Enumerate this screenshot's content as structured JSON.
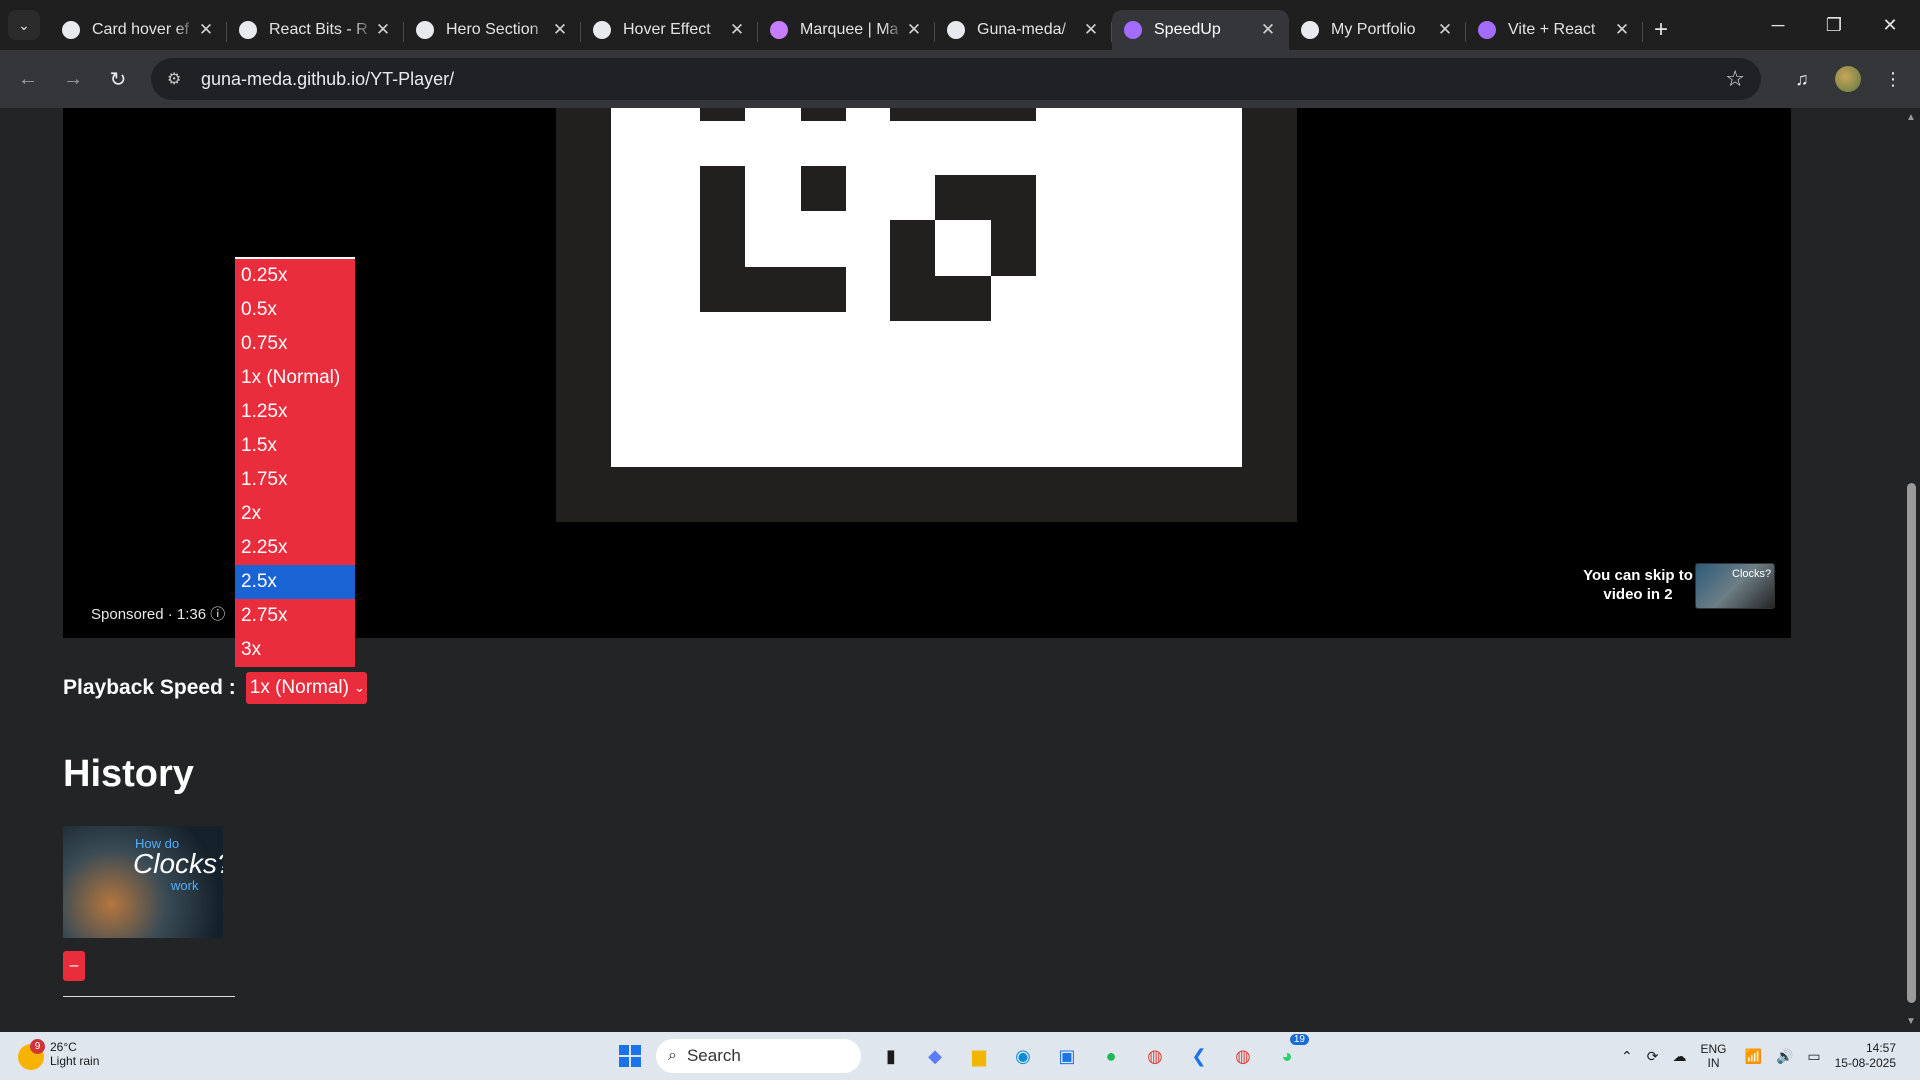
{
  "browser": {
    "tabs": [
      {
        "title": "Card hover ef",
        "favicon_color": "#e8eaed"
      },
      {
        "title": "React Bits - R",
        "favicon_color": "#e8eaed"
      },
      {
        "title": "Hero Section",
        "favicon_color": "#e8eaed"
      },
      {
        "title": "Hover Effect",
        "favicon_color": "#e8eaed"
      },
      {
        "title": "Marquee | Ma",
        "favicon_color": "#c77dff"
      },
      {
        "title": "Guna-meda/",
        "favicon_color": "#e8eaed"
      },
      {
        "title": "SpeedUp",
        "favicon_color": "#a46bff",
        "active": true
      },
      {
        "title": "My Portfolio",
        "favicon_color": "#e8eaed"
      },
      {
        "title": "Vite + React",
        "favicon_color": "#a46bff"
      }
    ],
    "url": "guna-meda.github.io/YT-Player/"
  },
  "player": {
    "sponsored_text": "Sponsored · 1:36",
    "skip_text_line1": "You can skip to",
    "skip_text_line2": "video in 2",
    "skip_thumb_text": "Clocks?"
  },
  "speed": {
    "label": "Playback Speed :",
    "selected_value": "1x (Normal)",
    "highlighted": "2.5x",
    "options": [
      "0.25x",
      "0.5x",
      "0.75x",
      "1x (Normal)",
      "1.25x",
      "1.5x",
      "1.75x",
      "2x",
      "2.25x",
      "2.5x",
      "2.75x",
      "3x"
    ]
  },
  "history": {
    "title": "History",
    "item": {
      "thumb_line1": "How do",
      "thumb_line2": "Clocks?",
      "thumb_line3": "work",
      "remove_label": "–"
    }
  },
  "taskbar": {
    "weather_temp": "26°C",
    "weather_desc": "Light rain",
    "weather_badge": "9",
    "search_placeholder": "Search",
    "whatsapp_badge": "19",
    "lang_line1": "ENG",
    "lang_line2": "IN",
    "time": "14:57",
    "date": "15-08-2025"
  },
  "colors": {
    "accent_red": "#ea2d3d",
    "highlight_blue": "#1a63d5",
    "page_bg": "#222426"
  }
}
